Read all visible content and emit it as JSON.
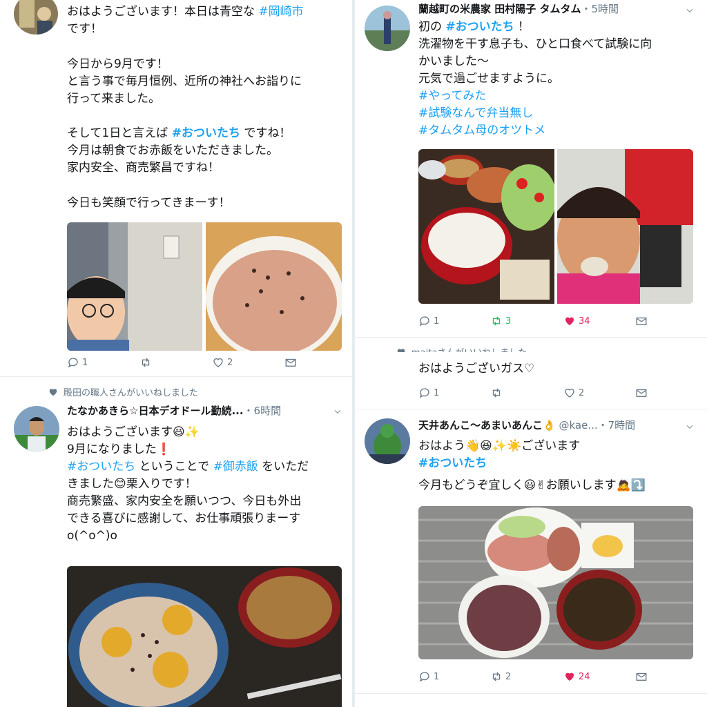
{
  "tweet1": {
    "line1a": "おはようございます！本日は青空な ",
    "line1_tag": "#岡崎市",
    "line2": "です！",
    "para2": "今日から9月です！\nと言う事で毎月恒例、近所の神社へお詣りに\n行って来ました。",
    "para3a": "そして1日と言えば ",
    "para3_tag": "#おついたち",
    "para3b": " ですね！",
    "para3rest": "今月は朝食でお赤飯をいただきました。\n家内安全、商売繁昌ですね！",
    "para4": "今日も笑顔で行ってきまーす！",
    "reply_count": "1",
    "retweet_count": "",
    "like_count": "2"
  },
  "tweet2": {
    "context": "殿田の職人さんがいいねしました",
    "name": "たなかあきら☆日本デオドール勤続...",
    "time": "・6時間",
    "line1": "おはようございます😃✨",
    "line2": "9月になりました❗",
    "tag1": "#おついたち",
    "mid": " ということで ",
    "tag2": "#御赤飯",
    "tail": " をいただ",
    "line4": "きました😊栗入りです！",
    "line5": "商売繁盛、家内安全を願いつつ、今日も外出",
    "line6": "できる喜びに感謝して、お仕事頑張りまーす",
    "line7": "o(^o^)o"
  },
  "tweet3": {
    "name": "蘭越町の米農家 田村陽子 タムタム",
    "time": "・5時間",
    "l1a": "初の ",
    "l1tag": "#おついたち",
    "l1b": " ！",
    "l2": "洗濯物を干す息子も、ひと口食べて試験に向",
    "l3": "かいました〜",
    "l4": "元気で過ごせますように。",
    "tag_a": "#やってみた",
    "tag_b": "#試験なんで弁当無し",
    "tag_c": "#タムタム母のオツトメ",
    "reply_count": "1",
    "retweet_count": "3",
    "like_count": "34"
  },
  "tweet4": {
    "context": "maitaさんがいいねしました",
    "text": "おはようございガス♡",
    "reply_count": "1",
    "like_count": "2"
  },
  "tweet5": {
    "name": "天井あんこ〜あまいあんこ👌",
    "handle": " @kae...",
    "time": "・7時間",
    "l1": "おはよう👋😆✨☀️ございます",
    "tag": "#おついたち",
    "l3": "今月もどうぞ宜しく😃✌お願いします🙇⤵️",
    "reply_count": "1",
    "retweet_count": "2",
    "like_count": "24"
  },
  "colors": {
    "link": "#1da1f2",
    "meta": "#657786",
    "retweet": "#17bf63",
    "like": "#e0245e"
  }
}
